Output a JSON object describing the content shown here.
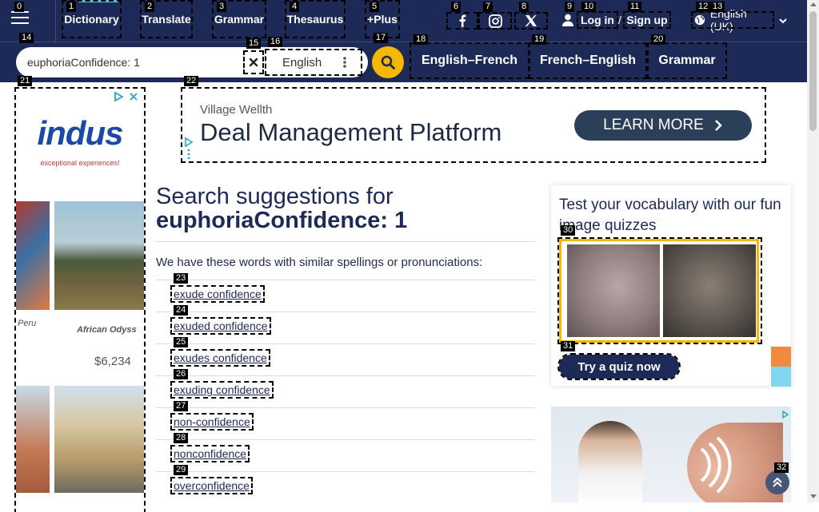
{
  "nav": {
    "items": [
      "Dictionary",
      "Translate",
      "Grammar",
      "Thesaurus",
      "+Plus"
    ],
    "login": "Log in",
    "slash": "/",
    "signup": "Sign up",
    "language": "English (UK)"
  },
  "search": {
    "value": "euphoriaConfidence: 1",
    "language": "English"
  },
  "links": [
    "English–French",
    "French–English",
    "Grammar"
  ],
  "ads": {
    "indus_logo": "indus",
    "indus_tagline": "exceptional experiences!",
    "indus_caption_left": "Peru",
    "indus_caption_right": "African Odyss",
    "indus_price": "$6,234",
    "banner_advertiser": "Village Wellth",
    "banner_title": "Deal Management Platform",
    "banner_cta": "LEARN MORE"
  },
  "main": {
    "heading_prefix": "Search suggestions for",
    "heading_term": "euphoriaConfidence: 1",
    "intro": "We have these words with similar spellings or pronunciations:",
    "suggestions": [
      "exude confidence",
      "exuded confidence",
      "exudes confidence",
      "exuding confidence",
      "non-confidence",
      "nonconfidence",
      "overconfidence"
    ]
  },
  "quiz": {
    "title": "Test your vocabulary with our fun image quizzes",
    "button": "Try a quiz now"
  },
  "markers": [
    "0",
    "1",
    "2",
    "3",
    "4",
    "5",
    "6",
    "7",
    "8",
    "9",
    "10",
    "11",
    "12",
    "13",
    "14",
    "15",
    "16",
    "17",
    "18",
    "19",
    "20",
    "21",
    "22",
    "23",
    "24",
    "25",
    "26",
    "27",
    "28",
    "29",
    "30",
    "31",
    "32"
  ],
  "colors": {
    "navy": "#1d2a57",
    "accent": "#f5b700",
    "quiz_frame": "#f5b700"
  }
}
